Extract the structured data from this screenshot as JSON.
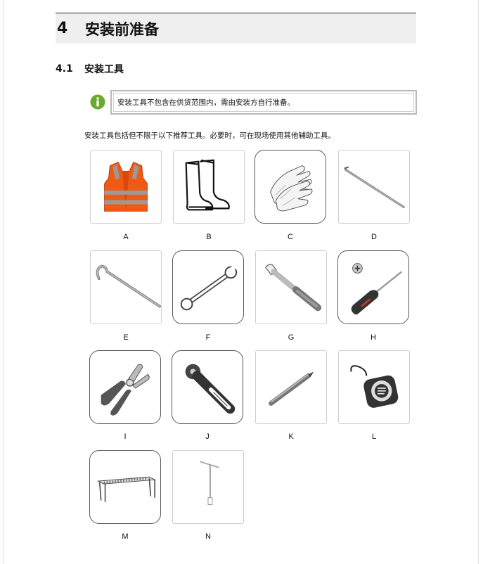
{
  "chapter": {
    "number": "4",
    "title": "安装前准备"
  },
  "section": {
    "number": "4.1",
    "title": "安装工具"
  },
  "note": {
    "icon": "info-icon",
    "text": "安装工具不包含在供货范围内，需由安装方自行准备。"
  },
  "intro": "安装工具包括但不限于以下推荐工具。必要时，可在现场使用其他辅助工具。",
  "colors": {
    "note_icon": "#6aab2e",
    "vest": "#f05a14",
    "stripe": "#9a9a9a"
  },
  "tools": [
    {
      "letter": "A",
      "icon": "safety-vest-icon"
    },
    {
      "letter": "B",
      "icon": "rubber-boots-icon"
    },
    {
      "letter": "C",
      "icon": "gloves-icon"
    },
    {
      "letter": "D",
      "icon": "pry-bar-icon"
    },
    {
      "letter": "E",
      "icon": "crowbar-icon"
    },
    {
      "letter": "F",
      "icon": "open-end-wrench-icon"
    },
    {
      "letter": "G",
      "icon": "ratchet-handle-icon"
    },
    {
      "letter": "H",
      "icon": "screwdriver-icon"
    },
    {
      "letter": "I",
      "icon": "pliers-icon"
    },
    {
      "letter": "J",
      "icon": "ratchet-wrench-icon"
    },
    {
      "letter": "K",
      "icon": "marker-pen-icon"
    },
    {
      "letter": "L",
      "icon": "tape-measure-icon"
    },
    {
      "letter": "M",
      "icon": "rail-frame-icon"
    },
    {
      "letter": "N",
      "icon": "t-handle-tool-icon"
    }
  ]
}
